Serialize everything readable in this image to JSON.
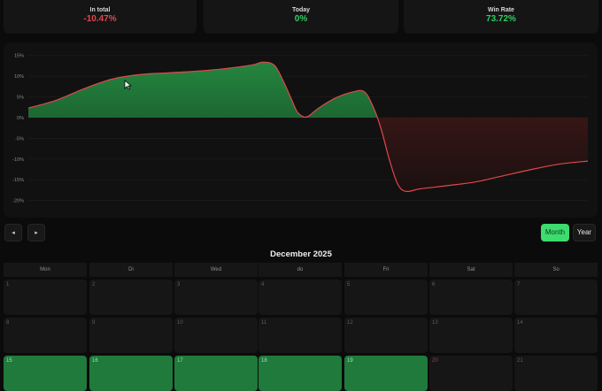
{
  "stats": [
    {
      "label": "In total",
      "value": "-10.47%",
      "tone": "neg"
    },
    {
      "label": "Today",
      "value": "0%",
      "tone": "pos"
    },
    {
      "label": "Win Rate",
      "value": "73.72%",
      "tone": "pos"
    }
  ],
  "chart_data": {
    "type": "area",
    "ylabel": "",
    "xlabel": "",
    "ylim": [
      -22,
      16
    ],
    "yticks": [
      15,
      10,
      5,
      0,
      -5,
      -10,
      -15,
      -20
    ],
    "ytick_labels": [
      "15%",
      "10%",
      "5%",
      "0%",
      "-5%",
      "-10%",
      "-15%",
      "-20%"
    ],
    "grid": true,
    "colors": {
      "positive": "#1e7a3a",
      "negative": "#5a1e1e",
      "line": "#e0474c"
    },
    "points": [
      [
        0.0,
        2.3
      ],
      [
        0.05,
        4.2
      ],
      [
        0.1,
        7.0
      ],
      [
        0.15,
        9.3
      ],
      [
        0.2,
        10.4
      ],
      [
        0.25,
        10.8
      ],
      [
        0.3,
        11.2
      ],
      [
        0.35,
        11.8
      ],
      [
        0.4,
        12.7
      ],
      [
        0.42,
        13.4
      ],
      [
        0.44,
        12.6
      ],
      [
        0.455,
        9.0
      ],
      [
        0.47,
        4.5
      ],
      [
        0.48,
        1.5
      ],
      [
        0.49,
        0.3
      ],
      [
        0.5,
        0.3
      ],
      [
        0.52,
        2.4
      ],
      [
        0.55,
        4.8
      ],
      [
        0.58,
        6.2
      ],
      [
        0.6,
        6.3
      ],
      [
        0.615,
        3.0
      ],
      [
        0.63,
        -2.5
      ],
      [
        0.645,
        -10.0
      ],
      [
        0.66,
        -16.0
      ],
      [
        0.675,
        -17.8
      ],
      [
        0.7,
        -17.2
      ],
      [
        0.75,
        -16.4
      ],
      [
        0.8,
        -15.5
      ],
      [
        0.85,
        -14.0
      ],
      [
        0.9,
        -12.5
      ],
      [
        0.95,
        -11.2
      ],
      [
        1.0,
        -10.5
      ]
    ]
  },
  "nav": {
    "prev_glyph": "◂",
    "next_glyph": "▸",
    "month_label": "Month",
    "year_label": "Year"
  },
  "calendar": {
    "title": "December 2025",
    "weekdays": [
      "Mon",
      "Di",
      "Wed",
      "do",
      "Fri",
      "Sat",
      "So"
    ],
    "rows": [
      [
        {
          "day": "1",
          "state": "empty"
        },
        {
          "day": "2",
          "state": "empty"
        },
        {
          "day": "3",
          "state": "empty"
        },
        {
          "day": "4",
          "state": "empty"
        },
        {
          "day": "5",
          "state": "empty"
        },
        {
          "day": "6",
          "state": "empty"
        },
        {
          "day": "7",
          "state": "empty"
        }
      ],
      [
        {
          "day": "8",
          "state": "empty"
        },
        {
          "day": "9",
          "state": "empty"
        },
        {
          "day": "10",
          "state": "empty"
        },
        {
          "day": "11",
          "state": "empty"
        },
        {
          "day": "12",
          "state": "empty"
        },
        {
          "day": "13",
          "state": "empty"
        },
        {
          "day": "14",
          "state": "empty"
        }
      ],
      [
        {
          "day": "15",
          "state": "green"
        },
        {
          "day": "16",
          "state": "green"
        },
        {
          "day": "17",
          "state": "green"
        },
        {
          "day": "18",
          "state": "green"
        },
        {
          "day": "19",
          "state": "green"
        },
        {
          "day": "20",
          "state": "dark-red"
        },
        {
          "day": "21",
          "state": "empty"
        }
      ]
    ]
  }
}
